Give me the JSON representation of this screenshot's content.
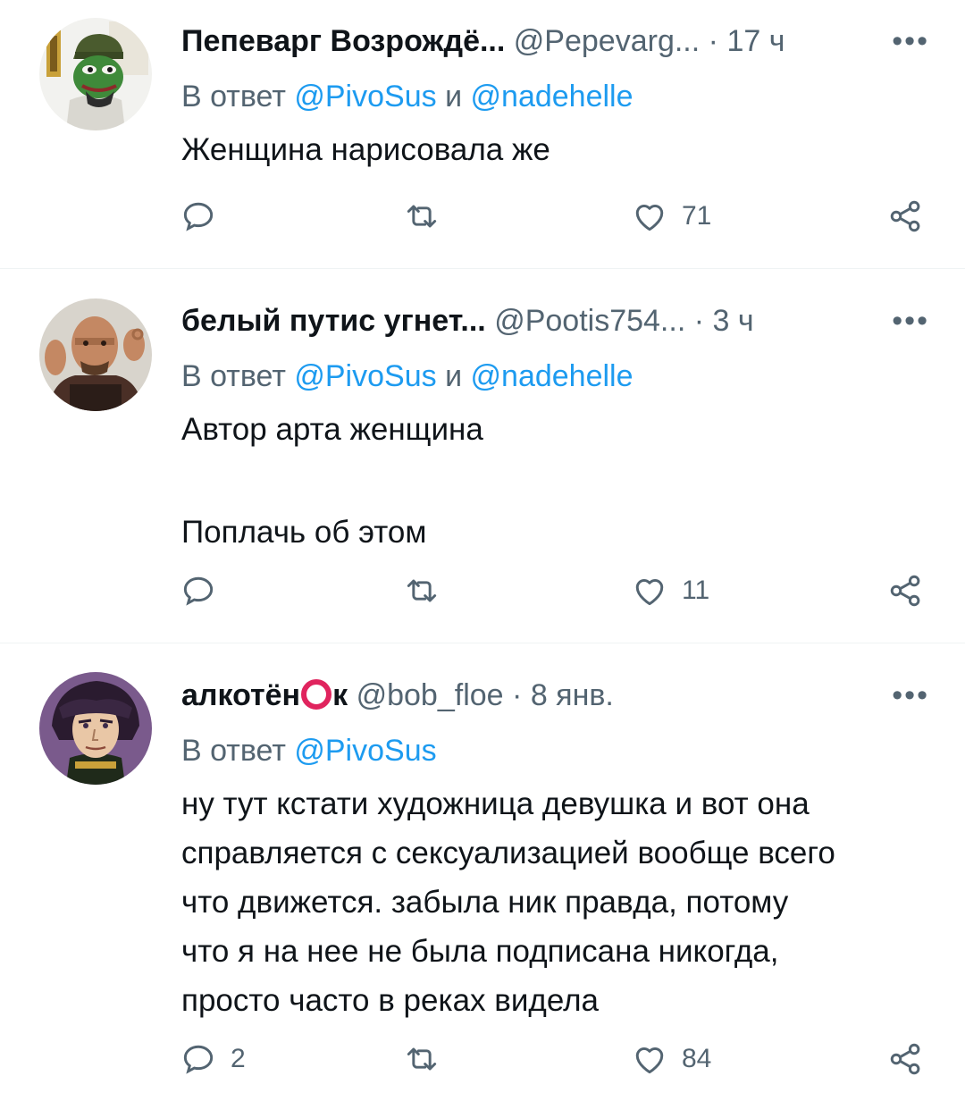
{
  "tweets": [
    {
      "name": "Пепеварг Возрождё...",
      "handle": "@Pepevarg...",
      "separator": "·",
      "time": "17 ч",
      "more": "•••",
      "reply_prefix": "В ответ",
      "mentions": [
        "@PivoSus",
        "@nadehelle"
      ],
      "mention_joiner": "и",
      "text_lines": [
        "Женщина нарисовала же"
      ],
      "replies": "",
      "retweets": "",
      "likes": "71"
    },
    {
      "name": "белый путис угнет...",
      "handle": "@Pootis754...",
      "separator": "·",
      "time": "3 ч",
      "more": "•••",
      "reply_prefix": "В ответ",
      "mentions": [
        "@PivoSus",
        "@nadehelle"
      ],
      "mention_joiner": "и",
      "text_lines": [
        "Автор арта женщина",
        "",
        "Поплачь об этом"
      ],
      "replies": "",
      "retweets": "",
      "likes": "11"
    },
    {
      "name_part1": "алкотён",
      "name_part2": "к",
      "handle": "@bob_floe",
      "separator": "·",
      "time": "8 янв.",
      "more": "•••",
      "reply_prefix": "В ответ",
      "mentions": [
        "@PivoSus"
      ],
      "text_lines": [
        "ну тут кстати художница девушка и вот она",
        "справляется с сексуализацией вообще всего",
        "что движется. забыла ник правда, потому",
        "что я на нее не была подписана никогда,",
        "просто часто в реках видела"
      ],
      "replies": "2",
      "retweets": "",
      "likes": "84"
    }
  ],
  "icons": {
    "reply": "reply-bubble-icon",
    "retweet": "retweet-icon",
    "like": "heart-icon",
    "share": "share-icon"
  },
  "colors": {
    "text": "#0f1419",
    "secondary": "#536471",
    "mention": "#1d9bf0",
    "divider": "#eff3f4",
    "name_ring": "#e0245e"
  }
}
